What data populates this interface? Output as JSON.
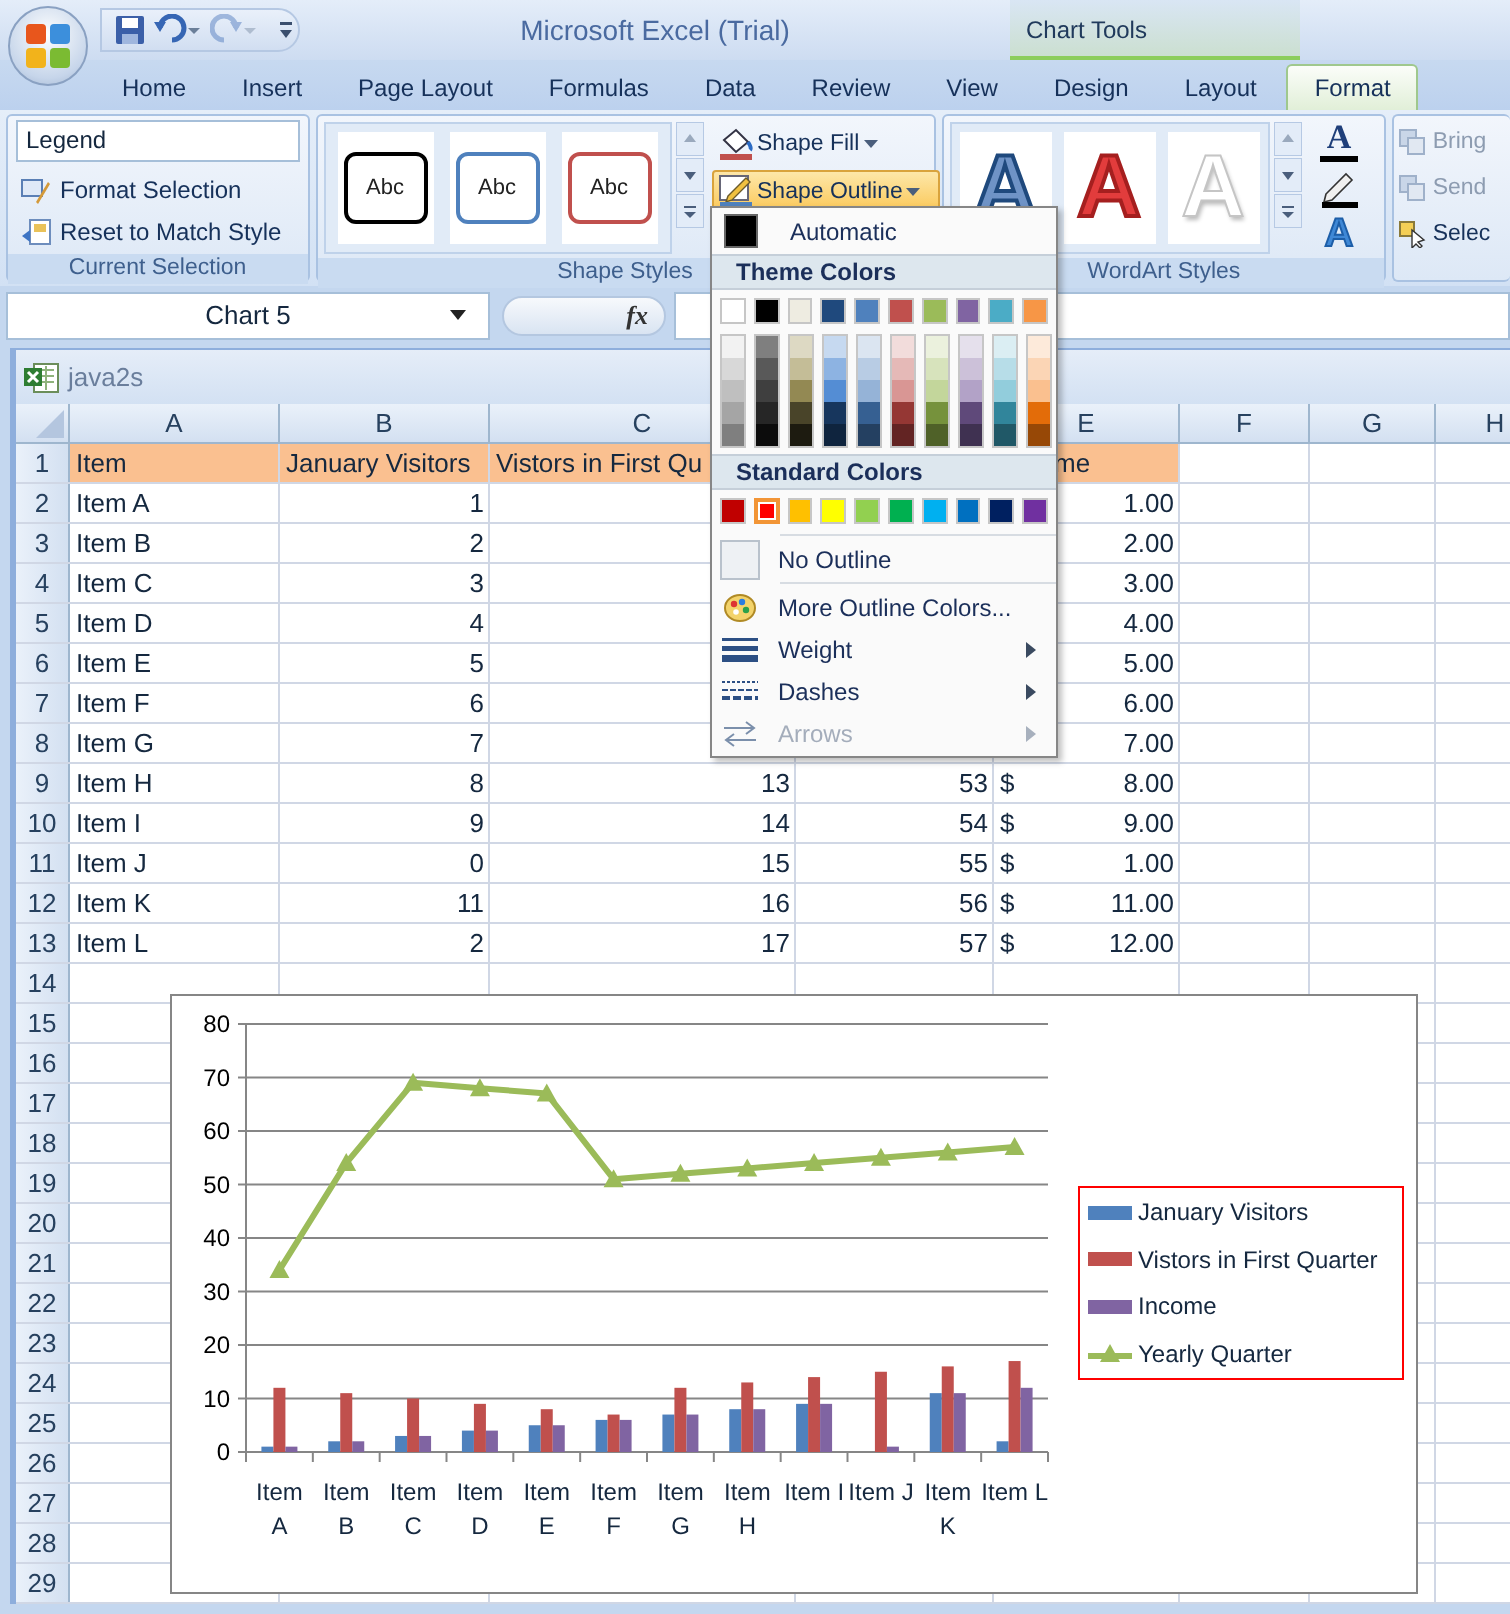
{
  "title_bar": {
    "title": "Microsoft Excel (Trial)",
    "context_label": "Chart Tools",
    "quick_access": [
      {
        "kind": "save",
        "disabled": false
      },
      {
        "kind": "undo",
        "disabled": false
      },
      {
        "kind": "redo",
        "disabled": true
      },
      {
        "kind": "customize",
        "disabled": false
      }
    ]
  },
  "tabs": [
    {
      "label": "Home",
      "selected": false
    },
    {
      "label": "Insert",
      "selected": false
    },
    {
      "label": "Page Layout",
      "selected": false
    },
    {
      "label": "Formulas",
      "selected": false
    },
    {
      "label": "Data",
      "selected": false
    },
    {
      "label": "Review",
      "selected": false
    },
    {
      "label": "View",
      "selected": false
    },
    {
      "label": "Design",
      "selected": false
    },
    {
      "label": "Layout",
      "selected": false
    },
    {
      "label": "Format",
      "selected": true
    }
  ],
  "ribbon": {
    "current_selection": {
      "dropdown_value": "Legend",
      "buttons": [
        {
          "label": "Format Selection",
          "kind": "format"
        },
        {
          "label": "Reset to Match Style",
          "kind": "reset"
        }
      ],
      "label": "Current Selection"
    },
    "shape_styles": {
      "samples": [
        {
          "text": "Abc",
          "color": "#000000"
        },
        {
          "text": "Abc",
          "color": "#4f81bd"
        },
        {
          "text": "Abc",
          "color": "#c0504d"
        }
      ],
      "buttons": [
        {
          "label": "Shape Fill",
          "kind": "fill",
          "selected": false
        },
        {
          "label": "Shape Outline",
          "kind": "outline",
          "selected": true
        }
      ],
      "label": "Shape Styles"
    },
    "wordart_styles": {
      "samples": [
        {
          "text": "A",
          "kind": "outline"
        },
        {
          "text": "A",
          "kind": "red"
        },
        {
          "text": "A",
          "kind": "white"
        }
      ],
      "text_fill": "A",
      "text_effects": "A",
      "label": "WordArt Styles"
    },
    "arrange": {
      "items": [
        {
          "label": "Bring",
          "kind": "bring",
          "disabled": true
        },
        {
          "label": "Send",
          "kind": "send",
          "disabled": true
        },
        {
          "label": "Selec",
          "kind": "select",
          "disabled": false
        }
      ]
    }
  },
  "formula_bar": {
    "name_box": "Chart 5",
    "fx": "fx"
  },
  "workbook": {
    "title": "java2s",
    "columns": [
      {
        "label": "A"
      },
      {
        "label": "B"
      },
      {
        "label": "C"
      },
      {},
      {
        "label": "E"
      },
      {
        "label": "F"
      },
      {
        "label": "G"
      },
      {
        "label": "H"
      }
    ],
    "rows": [
      {
        "number": "1",
        "header": true,
        "a": "Item",
        "b": "January Visitors",
        "c": "Vistors in First Qu",
        "e": "me"
      },
      {
        "number": "2",
        "header": false,
        "a": "Item A",
        "b": "1",
        "e": "1.00"
      },
      {
        "number": "3",
        "header": false,
        "a": "Item B",
        "b": "2",
        "e": "2.00"
      },
      {
        "number": "4",
        "header": false,
        "a": "Item C",
        "b": "3",
        "e": "3.00"
      },
      {
        "number": "5",
        "header": false,
        "a": "Item D",
        "b": "4",
        "e": "4.00"
      },
      {
        "number": "6",
        "header": false,
        "a": "Item E",
        "b": "5",
        "e": "5.00"
      },
      {
        "number": "7",
        "header": false,
        "a": "Item F",
        "b": "6",
        "e": "6.00"
      },
      {
        "number": "8",
        "header": false,
        "a": "Item G",
        "b": "7",
        "e": "7.00"
      },
      {
        "number": "9",
        "header": false,
        "a": "Item H",
        "b": "8",
        "c": "13",
        "d": "53",
        "currency": "$",
        "e": "8.00"
      },
      {
        "number": "10",
        "header": false,
        "a": "Item I",
        "b": "9",
        "c": "14",
        "d": "54",
        "currency": "$",
        "e": "9.00"
      },
      {
        "number": "11",
        "header": false,
        "a": "Item J",
        "b": "0",
        "c": "15",
        "d": "55",
        "currency": "$",
        "e": "1.00"
      },
      {
        "number": "12",
        "header": false,
        "a": "Item K",
        "b": "11",
        "c": "16",
        "d": "56",
        "currency": "$",
        "e": "11.00"
      },
      {
        "number": "13",
        "header": false,
        "a": "Item L",
        "b": "2",
        "c": "17",
        "d": "57",
        "currency": "$",
        "e": "12.00"
      },
      {
        "number": "14"
      },
      {
        "number": "15"
      },
      {
        "number": "16"
      },
      {
        "number": "17"
      },
      {
        "number": "18"
      },
      {
        "number": "19"
      },
      {
        "number": "20"
      },
      {
        "number": "21"
      },
      {
        "number": "22"
      },
      {
        "number": "23"
      },
      {
        "number": "24"
      },
      {
        "number": "25"
      },
      {
        "number": "26"
      },
      {
        "number": "27"
      },
      {
        "number": "28"
      },
      {
        "number": "29"
      }
    ],
    "chart": {
      "chart_data": {
        "type": "bar",
        "categories": [
          "Item A",
          "Item B",
          "Item C",
          "Item D",
          "Item E",
          "Item F",
          "Item G",
          "Item H",
          "Item I",
          "Item J",
          "Item K",
          "Item L"
        ],
        "series": [
          {
            "name": "January Visitors",
            "color": "#4f81bd",
            "values": [
              1,
              2,
              3,
              4,
              5,
              6,
              7,
              8,
              9,
              0,
              11,
              2
            ]
          },
          {
            "name": "Vistors in First Quarter",
            "color": "#c0504d",
            "values": [
              12,
              11,
              10,
              9,
              8,
              7,
              12,
              13,
              14,
              15,
              16,
              17
            ]
          },
          {
            "name": "Income",
            "color": "#8064a2",
            "values": [
              1,
              2,
              3,
              4,
              5,
              6,
              7,
              8,
              9,
              1,
              11,
              12
            ]
          },
          {
            "name": "Yearly Quarter",
            "color": "#9bbb59",
            "type": "line",
            "marker": "triangle",
            "values": [
              34,
              54,
              69,
              68,
              67,
              51,
              52,
              53,
              54,
              55,
              56,
              57
            ]
          }
        ],
        "ylim": [
          0,
          80
        ],
        "yticks": [
          0,
          10,
          20,
          30,
          40,
          50,
          60,
          70,
          80
        ],
        "grid": true,
        "legend": true
      }
    }
  },
  "outline_menu": {
    "automatic": {
      "label": "Automatic",
      "color": "#000000"
    },
    "theme_header": "Theme Colors",
    "theme_colors": [
      {
        "color": "#ffffff",
        "shades": [
          {
            "color": "#f2f2f2"
          },
          {
            "color": "#d8d8d8"
          },
          {
            "color": "#bfbfbf"
          },
          {
            "color": "#a5a5a5"
          },
          {
            "color": "#7f7f7f"
          }
        ]
      },
      {
        "color": "#000000",
        "shades": [
          {
            "color": "#7f7f7f"
          },
          {
            "color": "#595959"
          },
          {
            "color": "#3f3f3f"
          },
          {
            "color": "#262626"
          },
          {
            "color": "#0c0c0c"
          }
        ]
      },
      {
        "color": "#eeece1",
        "shades": [
          {
            "color": "#ddd9c3"
          },
          {
            "color": "#c4bd97"
          },
          {
            "color": "#938953"
          },
          {
            "color": "#494429"
          },
          {
            "color": "#1d1b10"
          }
        ]
      },
      {
        "color": "#1f497d",
        "shades": [
          {
            "color": "#c6d9f0"
          },
          {
            "color": "#8db3e2"
          },
          {
            "color": "#548dd4"
          },
          {
            "color": "#17365d"
          },
          {
            "color": "#0f243e"
          }
        ]
      },
      {
        "color": "#4f81bd",
        "shades": [
          {
            "color": "#dbe5f1"
          },
          {
            "color": "#b8cce4"
          },
          {
            "color": "#95b3d7"
          },
          {
            "color": "#366092"
          },
          {
            "color": "#244061"
          }
        ]
      },
      {
        "color": "#c0504d",
        "shades": [
          {
            "color": "#f2dcdb"
          },
          {
            "color": "#e5b9b7"
          },
          {
            "color": "#d99694"
          },
          {
            "color": "#953734"
          },
          {
            "color": "#632423"
          }
        ]
      },
      {
        "color": "#9bbb59",
        "shades": [
          {
            "color": "#ebf1dd"
          },
          {
            "color": "#d7e3bc"
          },
          {
            "color": "#c3d69b"
          },
          {
            "color": "#76923c"
          },
          {
            "color": "#4f6128"
          }
        ]
      },
      {
        "color": "#8064a2",
        "shades": [
          {
            "color": "#e5e0ec"
          },
          {
            "color": "#ccc1d9"
          },
          {
            "color": "#b2a2c7"
          },
          {
            "color": "#5f497a"
          },
          {
            "color": "#3f3151"
          }
        ]
      },
      {
        "color": "#4bacc6",
        "shades": [
          {
            "color": "#dbeef3"
          },
          {
            "color": "#b7dde8"
          },
          {
            "color": "#92cddc"
          },
          {
            "color": "#31859b"
          },
          {
            "color": "#205867"
          }
        ]
      },
      {
        "color": "#f79646",
        "shades": [
          {
            "color": "#fdeada"
          },
          {
            "color": "#fbd5b5"
          },
          {
            "color": "#fac08f"
          },
          {
            "color": "#e36c09"
          },
          {
            "color": "#974806"
          }
        ]
      }
    ],
    "standard_header": "Standard Colors",
    "standard_colors": [
      {
        "color": "#c00000",
        "selected": false
      },
      {
        "color": "#ff0000",
        "selected": true
      },
      {
        "color": "#ffc000",
        "selected": false
      },
      {
        "color": "#ffff00",
        "selected": false
      },
      {
        "color": "#92d050",
        "selected": false
      },
      {
        "color": "#00b050",
        "selected": false
      },
      {
        "color": "#00b0f0",
        "selected": false
      },
      {
        "color": "#0070c0",
        "selected": false
      },
      {
        "color": "#002060",
        "selected": false
      },
      {
        "color": "#7030a0",
        "selected": false
      }
    ],
    "items": [
      {
        "label": "No Outline",
        "kind": "none",
        "submenu": false,
        "disabled": false
      },
      {
        "label": "More Outline Colors...",
        "kind": "more",
        "submenu": false,
        "disabled": false
      },
      {
        "label": "Weight",
        "kind": "weight",
        "submenu": true,
        "disabled": false
      },
      {
        "label": "Dashes",
        "kind": "dashes",
        "submenu": true,
        "disabled": false
      },
      {
        "label": "Arrows",
        "kind": "arrows",
        "submenu": true,
        "disabled": true
      }
    ]
  }
}
